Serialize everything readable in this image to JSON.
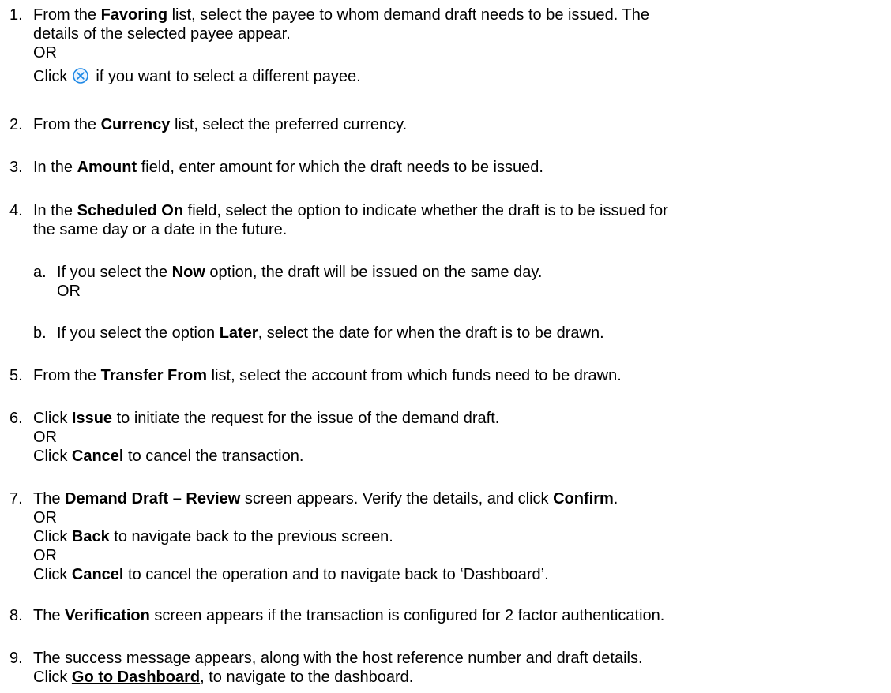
{
  "steps": [
    {
      "num": "1.",
      "l1a": "From the ",
      "l1b": "Favoring",
      "l1c": " list, select the payee to whom demand draft needs to be issued. The",
      "l2": "details of the selected payee appear.",
      "or": "OR",
      "l4a": "Click",
      "l4b": "if you want to select a different payee.",
      "icon": "clear-circle-icon",
      "icon_color": "#1e88e5"
    },
    {
      "num": "2.",
      "a": "From the ",
      "b": "Currency",
      "c": " list, select the preferred currency."
    },
    {
      "num": "3.",
      "a": "In the ",
      "b": "Amount",
      "c": " field, enter amount for which the draft needs to be issued."
    },
    {
      "num": "4.",
      "a": "In the ",
      "b": "Scheduled On",
      "c": " field, select the option to indicate whether the draft is to be issued for",
      "l2": "the same day or a date in the future.",
      "subs": [
        {
          "letter": "a.",
          "a": "If you select the ",
          "b": "Now",
          "c": " option, the draft will be issued on the same day.",
          "or": "OR"
        },
        {
          "letter": "b.",
          "a": "If you select the option ",
          "b": "Later",
          "c": ", select the date for when the draft is to be drawn."
        }
      ]
    },
    {
      "num": "5.",
      "a": "From the ",
      "b": "Transfer From",
      "c": " list, select the account from which funds need to be drawn."
    },
    {
      "num": "6.",
      "a": "Click ",
      "b": "Issue",
      "c": " to initiate the request for the issue of the demand draft.",
      "or": "OR",
      "d": "Click ",
      "e": "Cancel",
      "f": " to cancel the transaction."
    },
    {
      "num": "7.",
      "a": "The ",
      "b": "Demand Draft – Review",
      "c": " screen appears. Verify the details, and click ",
      "d": "Confirm",
      "e": ".",
      "or1": "OR",
      "f": "Click ",
      "g": "Back",
      "h": " to navigate back to the previous screen.",
      "or2": "OR",
      "i": "Click ",
      "j": "Cancel",
      "k": " to cancel the operation and to navigate back to ‘Dashboard’."
    },
    {
      "num": "8.",
      "a": "The ",
      "b": "Verification",
      "c": " screen appears if the transaction is configured for 2 factor authentication."
    },
    {
      "num": "9.",
      "l1": "The success message appears, along with the host reference number and draft details.",
      "a": "Click ",
      "b": "Go to Dashboard",
      "c": ", to navigate to the dashboard."
    }
  ]
}
